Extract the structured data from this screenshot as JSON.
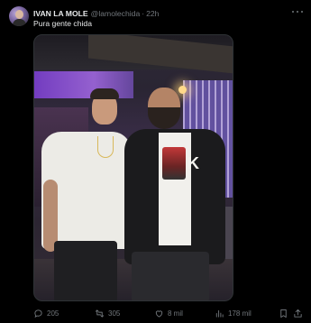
{
  "tweet": {
    "author_name": "IVAN LA MOLE",
    "handle": "@lamolechida",
    "separator": "·",
    "time": "22h",
    "text": "Pura gente chida"
  },
  "media": {
    "jacket_letter": "K"
  },
  "actions": {
    "reply_count": "205",
    "retweet_count": "305",
    "like_count": "8 mil",
    "views_count": "178 mil"
  },
  "icons": {
    "reply": "reply-icon",
    "retweet": "retweet-icon",
    "like": "heart-icon",
    "views": "bar-chart-icon",
    "bookmark": "bookmark-icon",
    "share": "share-icon",
    "more": "more-horizontal-icon"
  },
  "colors": {
    "background": "#000000",
    "text": "#e7e9ea",
    "secondary": "#71767b"
  }
}
